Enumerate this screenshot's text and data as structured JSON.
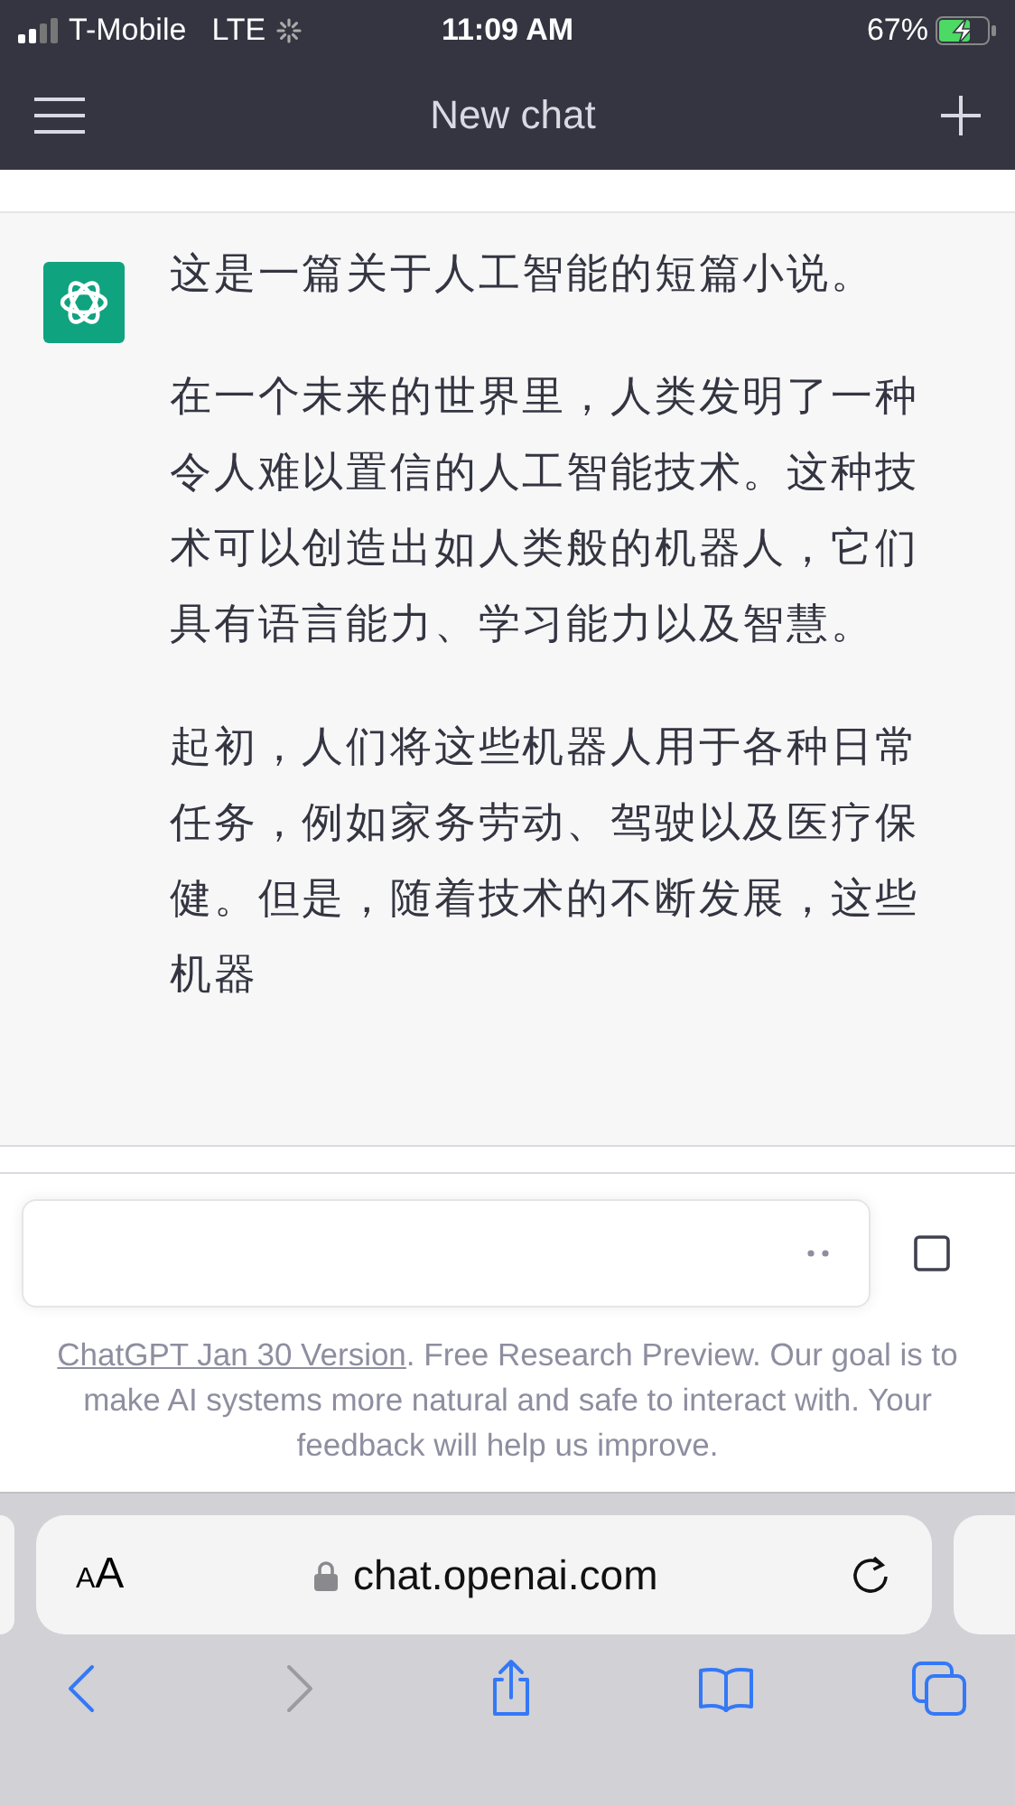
{
  "status_bar": {
    "carrier": "T-Mobile",
    "network": "LTE",
    "time": "11:09 AM",
    "battery": "67%"
  },
  "header": {
    "title": "New chat"
  },
  "message": {
    "paragraphs": [
      "这是一篇关于人工智能的短篇小说。",
      "在一个未来的世界里，人类发明了一种令人难以置信的人工智能技术。这种技术可以创造出如人类般的机器人，它们具有语言能力、学习能力以及智慧。",
      "起初，人们将这些机器人用于各种日常任务，例如家务劳动、驾驶以及医疗保健。但是，随着技术的不断发展，这些机器"
    ]
  },
  "footer": {
    "link": "ChatGPT Jan 30 Version",
    "text": ". Free Research Preview. Our goal is to make AI systems more natural and safe to interact with. Your feedback will help us improve."
  },
  "browser": {
    "text_size": "AA",
    "url": "chat.openai.com"
  },
  "toolbar": [
    {
      "kind": "back",
      "disabled": false
    },
    {
      "kind": "forward",
      "disabled": true
    },
    {
      "kind": "share",
      "disabled": false
    },
    {
      "kind": "bookmarks",
      "disabled": false
    },
    {
      "kind": "tabs",
      "disabled": false
    }
  ]
}
